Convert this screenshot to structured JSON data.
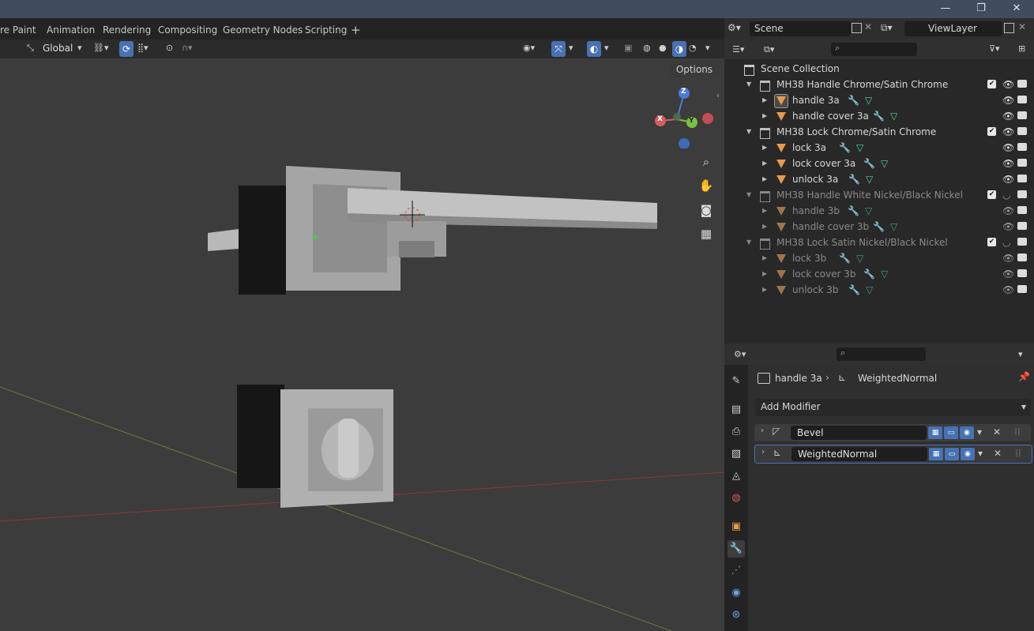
{
  "window": {
    "minimize": "—",
    "maximize": "❐",
    "close": "✕"
  },
  "workspace_tabs": [
    "re Paint",
    "Animation",
    "Rendering",
    "Compositing",
    "Geometry Nodes",
    "Scripting",
    "+"
  ],
  "scene": {
    "name": "Scene",
    "view_layer": "ViewLayer"
  },
  "viewport": {
    "orientation": "Global",
    "options_label": "Options",
    "gizmo": {
      "z": "Z",
      "x": "X",
      "y": "Y"
    }
  },
  "outliner": {
    "root": "Scene Collection",
    "rows": [
      {
        "label": "MH38 Handle Chrome/Satin Chrome",
        "kind": "collection",
        "dim": false
      },
      {
        "label": "handle 3a",
        "kind": "mesh",
        "dim": false,
        "active": true
      },
      {
        "label": "handle cover 3a",
        "kind": "mesh",
        "dim": false
      },
      {
        "label": "MH38 Lock Chrome/Satin Chrome",
        "kind": "collection",
        "dim": false
      },
      {
        "label": "lock 3a",
        "kind": "mesh",
        "dim": false
      },
      {
        "label": "lock cover 3a",
        "kind": "mesh",
        "dim": false
      },
      {
        "label": "unlock 3a",
        "kind": "mesh",
        "dim": false
      },
      {
        "label": "MH38 Handle White Nickel/Black Nickel",
        "kind": "collection",
        "dim": true
      },
      {
        "label": "handle 3b",
        "kind": "mesh",
        "dim": true
      },
      {
        "label": "handle cover 3b",
        "kind": "mesh",
        "dim": true
      },
      {
        "label": "MH38 Lock Satin Nickel/Black Nickel",
        "kind": "collection",
        "dim": true
      },
      {
        "label": "lock 3b",
        "kind": "mesh",
        "dim": true
      },
      {
        "label": "lock cover 3b",
        "kind": "mesh",
        "dim": true
      },
      {
        "label": "unlock 3b",
        "kind": "mesh",
        "dim": true
      }
    ]
  },
  "properties": {
    "breadcrumb_object": "handle 3a",
    "breadcrumb_modifier": "WeightedNormal",
    "add_modifier": "Add Modifier",
    "modifiers": [
      {
        "name": "Bevel",
        "active": false
      },
      {
        "name": "WeightedNormal",
        "active": true
      }
    ]
  },
  "colors": {
    "accent": "#4772b3",
    "mesh": "#e79a4c",
    "modifier": "#6fa0e8",
    "data": "#52d6a3"
  }
}
